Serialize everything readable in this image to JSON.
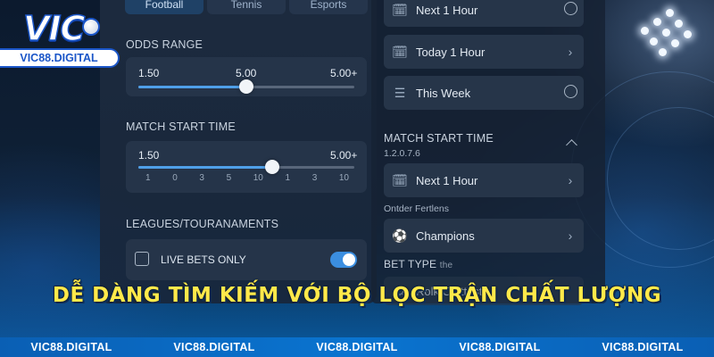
{
  "logo": {
    "brand": "VIC",
    "domain": "VIC88.DIGITAL"
  },
  "tabs": [
    {
      "label": "Football",
      "icon": "football-icon"
    },
    {
      "label": "Tennis",
      "icon": "tennis-icon"
    },
    {
      "label": "Esports",
      "icon": "esports-icon"
    }
  ],
  "odds_range": {
    "title": "ODDS RANGE",
    "min_label": "1.50",
    "mid_label": "5.00",
    "max_label": "5.00+",
    "level_percent": 50
  },
  "match_start_left": {
    "title": "MATCH START TIME",
    "min_label": "1.50",
    "max_label": "5.00+",
    "level_percent": 62,
    "ticks": [
      "1",
      "0",
      "3",
      "5",
      "10",
      "1",
      "3",
      "10"
    ]
  },
  "leagues": {
    "title": "LEAGUES/TOURANAMENTS",
    "live_bets_label": "LIVE BETS ONLY",
    "live_bets_on": true
  },
  "right_panel": {
    "time_options": [
      {
        "label": "Next 1 Hour",
        "icon": "calendar-icon",
        "control": "radio"
      },
      {
        "label": "Today 1 Hour",
        "icon": "calendar-icon",
        "control": "chevron"
      },
      {
        "label": "This Week",
        "icon": "list-icon",
        "control": "radio"
      }
    ],
    "match_start_title": "MATCH START TIME",
    "match_start_sub": "1.2.0.7.6",
    "next_hour_label": "Next 1 Hour",
    "other_label": "Ontder Fertlens",
    "champions_label": "Champions",
    "bet_type_title": "BET TYPE",
    "bet_type_suffix": "the",
    "bet_type_option": "Rolk Onlttest"
  },
  "headline": "DỄ DÀNG TÌM KIẾM VỚI BỘ LỌC TRẬN CHẤT LƯỢNG",
  "footer": [
    "VIC88.DIGITAL",
    "VIC88.DIGITAL",
    "VIC88.DIGITAL",
    "VIC88.DIGITAL",
    "VIC88.DIGITAL"
  ],
  "colors": {
    "accent": "#4f9fe8",
    "headline": "#ffe94a",
    "footer_bg": "#0a74d0"
  }
}
